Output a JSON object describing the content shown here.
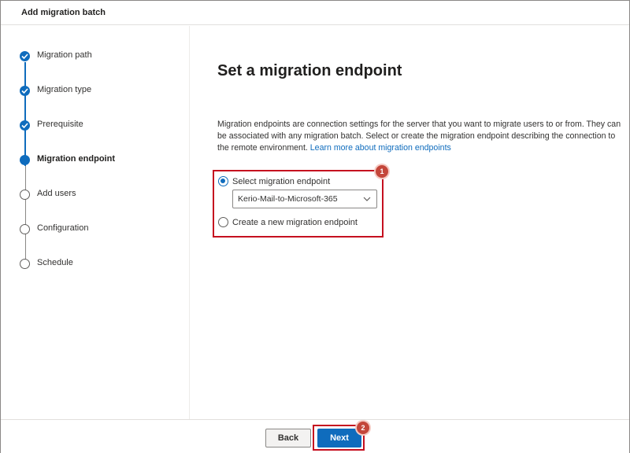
{
  "window": {
    "title": "Add migration batch"
  },
  "steps": [
    {
      "label": "Migration path",
      "state": "done"
    },
    {
      "label": "Migration type",
      "state": "done"
    },
    {
      "label": "Prerequisite",
      "state": "done"
    },
    {
      "label": "Migration endpoint",
      "state": "current"
    },
    {
      "label": "Add users",
      "state": "todo"
    },
    {
      "label": "Configuration",
      "state": "todo"
    },
    {
      "label": "Schedule",
      "state": "todo"
    }
  ],
  "main": {
    "title": "Set a migration endpoint",
    "description": "Migration endpoints are connection settings for the server that you want to migrate users to or from. They can be associated with any migration batch. Select or create the migration endpoint describing the connection to the remote environment.",
    "learn_more": "Learn more about migration endpoints",
    "options": {
      "select_label": "Select migration endpoint",
      "create_label": "Create a new migration endpoint"
    },
    "dropdown": {
      "selected": "Kerio-Mail-to-Microsoft-365"
    }
  },
  "annotations": {
    "badge1": "1",
    "badge2": "2"
  },
  "footer": {
    "back_label": "Back",
    "next_label": "Next"
  },
  "colors": {
    "accent": "#0f6cbd",
    "highlight": "#c50f1f",
    "badge": "#c4463a"
  },
  "icons": {
    "check": "checkmark-icon",
    "chevron": "chevron-down-icon"
  }
}
